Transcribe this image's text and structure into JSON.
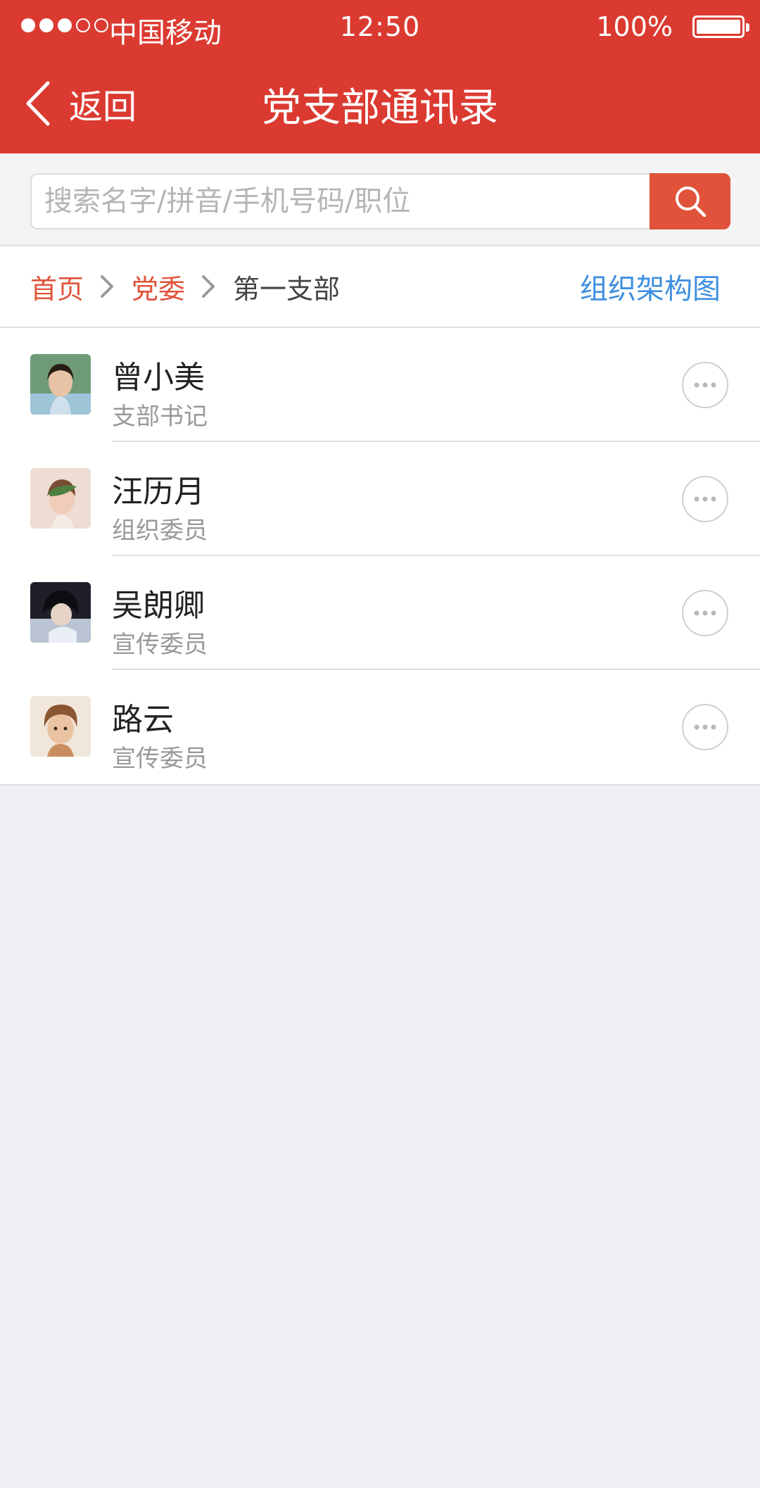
{
  "status_bar": {
    "signal_dots": [
      "full",
      "full",
      "full",
      "empty",
      "empty"
    ],
    "carrier": "中国移动",
    "time": "12:50",
    "battery_percent": "100%",
    "battery_level": 1.0
  },
  "navbar": {
    "back_label": "返回",
    "title": "党支部通讯录"
  },
  "search": {
    "placeholder": "搜索名字/拼音/手机号码/职位",
    "value": ""
  },
  "breadcrumb": {
    "items": [
      "首页",
      "党委",
      "第一支部"
    ],
    "org_chart_link": "组织架构图"
  },
  "members": [
    {
      "name": "曾小美",
      "role": "支部书记",
      "avatar": "portrait-girl-photo"
    },
    {
      "name": "汪历月",
      "role": "组织委员",
      "avatar": "portrait-leaf-photo"
    },
    {
      "name": "吴朗卿",
      "role": "宣传委员",
      "avatar": "portrait-dark-photo"
    },
    {
      "name": "路云",
      "role": "宣传委员",
      "avatar": "portrait-child-photo"
    }
  ],
  "colors": {
    "header_red": "#db3a31",
    "search_button": "#e0533a",
    "breadcrumb_link": "#e0533a",
    "org_link_blue": "#3d8fe0",
    "page_background": "#efeff4"
  },
  "icons": {
    "back": "chevron-left-icon",
    "search": "magnifier-icon",
    "breadcrumb_separator": "chevron-right-icon",
    "more": "more-dots-icon"
  }
}
